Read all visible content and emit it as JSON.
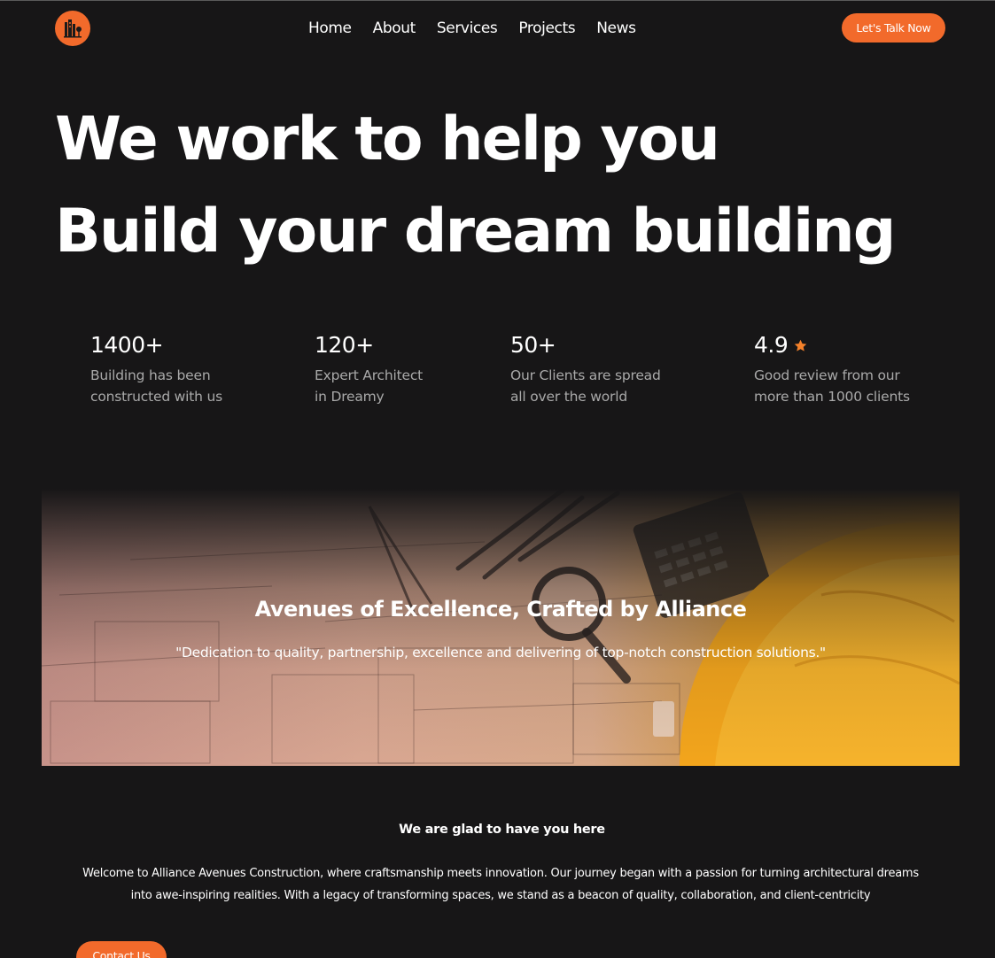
{
  "header": {
    "nav": [
      "Home",
      "About",
      "Services",
      "Projects",
      "News"
    ],
    "cta_label": "Let's Talk Now"
  },
  "hero": {
    "line1": "We work to help you",
    "line2": "Build your dream building"
  },
  "stats": [
    {
      "value": "1400+",
      "line1": "Building has been",
      "line2": "constructed with us"
    },
    {
      "value": "120+",
      "line1": "Expert Architect",
      "line2": "in Dreamy"
    },
    {
      "value": "50+",
      "line1": "Our Clients are spread",
      "line2": "all over the world"
    },
    {
      "value": "4.9",
      "line1": "Good review from our",
      "line2": "more than 1000 clients",
      "icon": "star-icon"
    }
  ],
  "banner": {
    "title": "Avenues of Excellence, Crafted by Alliance",
    "quote": "\"Dedication to quality, partnership, excellence and delivering of top-notch construction solutions.\""
  },
  "welcome": {
    "title": "We are glad to have you here",
    "body_line1": "Welcome to Alliance Avenues Construction, where craftsmanship meets innovation. Our journey began with a passion for turning architectural dreams",
    "body_line2": "into awe-inspiring realities. With a legacy of transforming spaces, we stand as a beacon of quality, collaboration, and client-centricity",
    "contact_label": "Contact Us"
  },
  "colors": {
    "accent": "#f26a2b",
    "background": "#171617",
    "muted_text": "#a9a9a9",
    "star": "#f5812a"
  }
}
